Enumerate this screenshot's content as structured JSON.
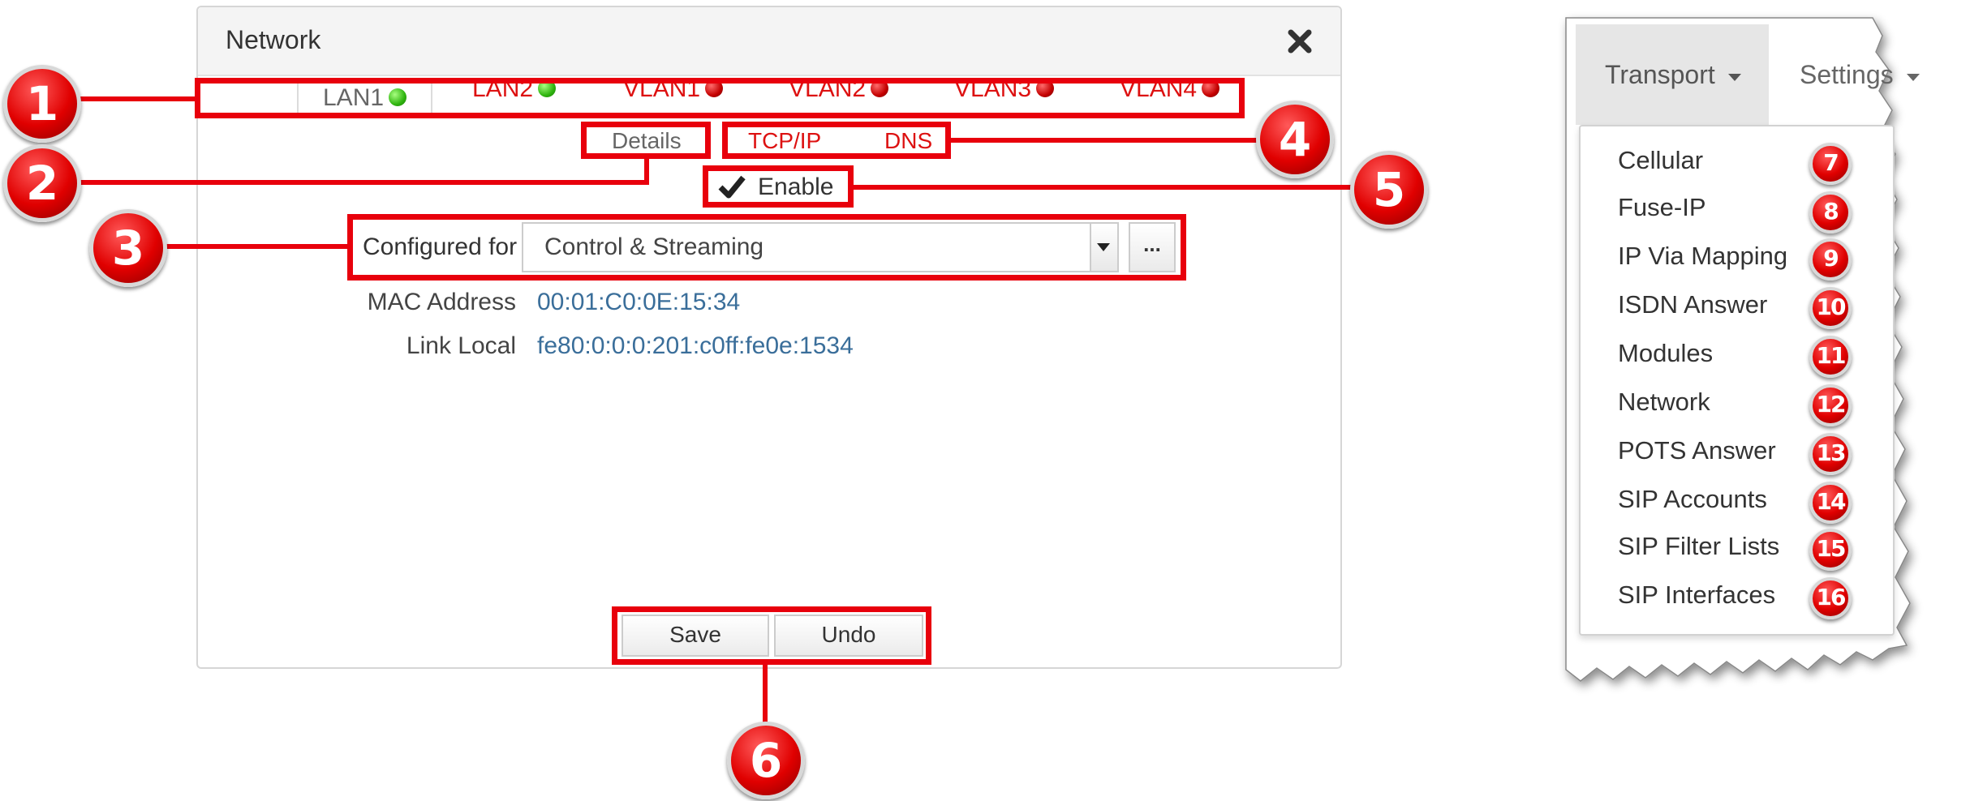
{
  "dialog": {
    "title": "Network",
    "tabs": [
      {
        "label": "LAN1",
        "status_color": "#2fb40f",
        "active": true
      },
      {
        "label": "LAN2",
        "status_color": "#2fb40f",
        "active": false
      },
      {
        "label": "VLAN1",
        "status_color": "#c40000",
        "active": false
      },
      {
        "label": "VLAN2",
        "status_color": "#c40000",
        "active": false
      },
      {
        "label": "VLAN3",
        "status_color": "#c40000",
        "active": false
      },
      {
        "label": "VLAN4",
        "status_color": "#c40000",
        "active": false
      }
    ],
    "subtabs": [
      {
        "label": "Details",
        "active": true
      },
      {
        "label": "TCP/IP",
        "active": false
      },
      {
        "label": "DNS",
        "active": false
      }
    ],
    "enable": {
      "label": "Enable",
      "checked": true
    },
    "configured_for": {
      "label": "Configured for",
      "value": "Control & Streaming",
      "more_label": "..."
    },
    "mac_address": {
      "label": "MAC Address",
      "value": "00:01:C0:0E:15:34"
    },
    "link_local": {
      "label": "Link Local",
      "value": "fe80:0:0:0:201:c0ff:fe0e:1534"
    },
    "buttons": {
      "save": "Save",
      "undo": "Undo"
    }
  },
  "callouts": {
    "c1": "1",
    "c2": "2",
    "c3": "3",
    "c4": "4",
    "c5": "5",
    "c6": "6"
  },
  "menu": {
    "tabs": {
      "transport": "Transport",
      "settings": "Settings"
    },
    "items": [
      {
        "label": "Cellular",
        "badge": "7"
      },
      {
        "label": "Fuse-IP",
        "badge": "8"
      },
      {
        "label": "IP Via Mapping",
        "badge": "9"
      },
      {
        "label": "ISDN Answer",
        "badge": "10"
      },
      {
        "label": "Modules",
        "badge": "11"
      },
      {
        "label": "Network",
        "badge": "12"
      },
      {
        "label": "POTS Answer",
        "badge": "13"
      },
      {
        "label": "SIP Accounts",
        "badge": "14"
      },
      {
        "label": "SIP Filter Lists",
        "badge": "15"
      },
      {
        "label": "SIP Interfaces",
        "badge": "16"
      }
    ]
  },
  "colors": {
    "callout_red": "#e8000c",
    "link_blue": "#3a6e9a",
    "tab_red": "#dd1111"
  }
}
